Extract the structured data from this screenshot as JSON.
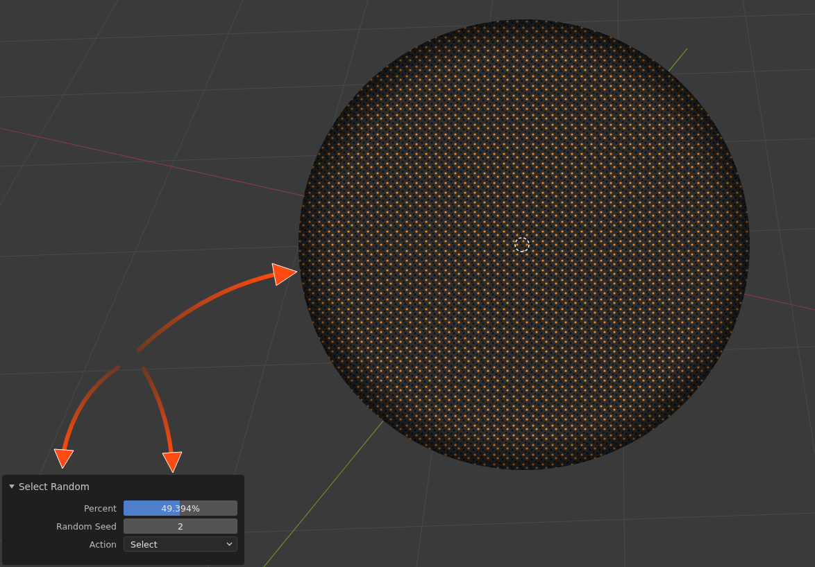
{
  "operator_panel": {
    "title": "Select Random",
    "expanded": true,
    "fields": [
      {
        "kind": "slider",
        "label": "Percent",
        "value": "49.394%",
        "level": 0.494
      },
      {
        "kind": "number",
        "label": "Random Seed",
        "value": "2"
      },
      {
        "kind": "dropdown",
        "label": "Action",
        "value": "Select"
      }
    ]
  }
}
